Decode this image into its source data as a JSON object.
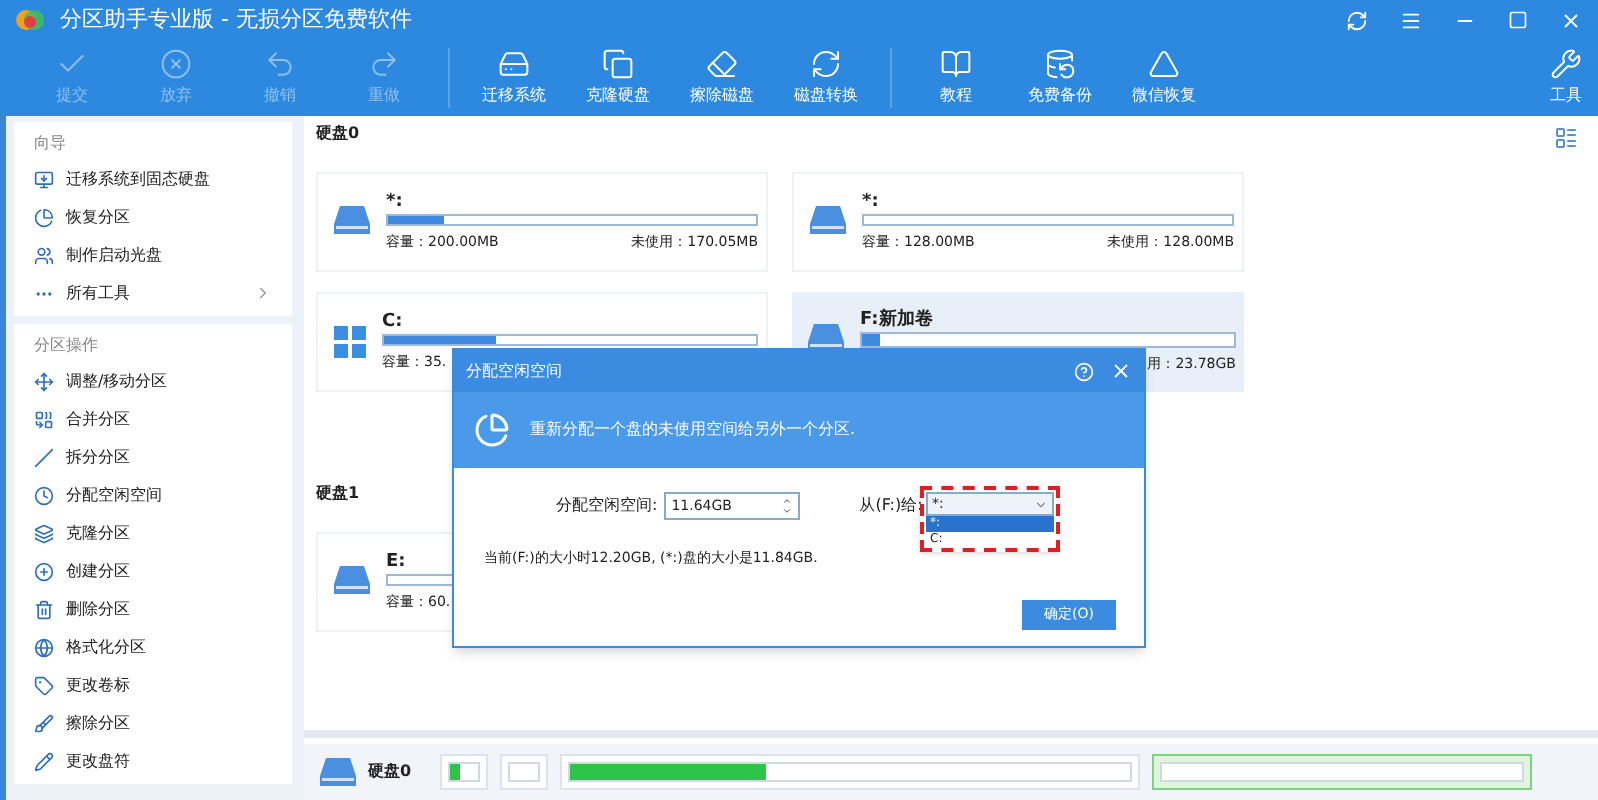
{
  "window": {
    "title": "分区助手专业版 - 无损分区免费软件"
  },
  "toolbar": {
    "groups": [
      [
        {
          "label": "提交",
          "disabled": true
        },
        {
          "label": "放弃",
          "disabled": true
        },
        {
          "label": "撤销",
          "disabled": true
        },
        {
          "label": "重做",
          "disabled": true
        }
      ],
      [
        {
          "label": "迁移系统",
          "disabled": false
        },
        {
          "label": "克隆硬盘",
          "disabled": false
        },
        {
          "label": "擦除磁盘",
          "disabled": false
        },
        {
          "label": "磁盘转换",
          "disabled": false
        }
      ],
      [
        {
          "label": "教程",
          "disabled": false
        },
        {
          "label": "免费备份",
          "disabled": false
        },
        {
          "label": "微信恢复",
          "disabled": false
        }
      ]
    ],
    "tools": {
      "label": "工具"
    }
  },
  "sidebar": {
    "sections": [
      {
        "title": "向导",
        "items": [
          {
            "label": "迁移系统到固态硬盘",
            "kind": "plain"
          },
          {
            "label": "恢复分区",
            "kind": "plain"
          },
          {
            "label": "制作启动光盘",
            "kind": "plain"
          },
          {
            "label": "所有工具",
            "kind": "submenu"
          }
        ]
      },
      {
        "title": "分区操作",
        "items": [
          {
            "label": "调整/移动分区",
            "kind": "plain"
          },
          {
            "label": "合并分区",
            "kind": "plain"
          },
          {
            "label": "拆分分区",
            "kind": "plain"
          },
          {
            "label": "分配空闲空间",
            "kind": "plain"
          },
          {
            "label": "克隆分区",
            "kind": "plain"
          },
          {
            "label": "创建分区",
            "kind": "plain"
          },
          {
            "label": "删除分区",
            "kind": "plain"
          },
          {
            "label": "格式化分区",
            "kind": "plain"
          },
          {
            "label": "更改卷标",
            "kind": "plain"
          },
          {
            "label": "擦除分区",
            "kind": "plain"
          },
          {
            "label": "更改盘符",
            "kind": "plain"
          }
        ]
      }
    ]
  },
  "disks": [
    {
      "label": "硬盘0",
      "partitions": [
        {
          "name": "*:",
          "kind": "data",
          "level": 0.15,
          "selected": false,
          "capacity": "容量：200.00MB",
          "free": "未使用：170.05MB"
        },
        {
          "name": "*:",
          "kind": "data",
          "selected": false,
          "capacity": "容量：128.00MB",
          "free": "未使用：128.00MB"
        },
        {
          "name": "C:",
          "kind": "system",
          "level": 0.3,
          "selected": false,
          "capacity": "容量：35."
        },
        {
          "name": "F:新加卷",
          "kind": "data",
          "level": 0.05,
          "selected": true,
          "free": "用：23.78GB"
        }
      ]
    },
    {
      "label": "硬盘1",
      "partitions": [
        {
          "name": "E:",
          "kind": "data",
          "selected": false,
          "capacity": "容量：60."
        }
      ]
    }
  ],
  "map": {
    "label": "硬盘0",
    "partitions": [
      {
        "level": 0.4,
        "selected": false
      },
      {
        "selected": false
      },
      {
        "level": 0.35,
        "selected": false
      },
      {
        "selected": true
      }
    ]
  },
  "dialog": {
    "title": "分配空闲空间",
    "description": "重新分配一个盘的未使用空间给另外一个分区.",
    "size_label": "分配空闲空间:",
    "size_value": "11.64GB",
    "from_label": "从(F:)给:",
    "select_value": "*:",
    "options": [
      {
        "label": "*:",
        "selected": true
      },
      {
        "label": "C:",
        "selected": false
      }
    ],
    "info": "当前(F:)的大小时12.20GB, (*:)盘的大小是11.84GB.",
    "ok": "确定(O)"
  }
}
